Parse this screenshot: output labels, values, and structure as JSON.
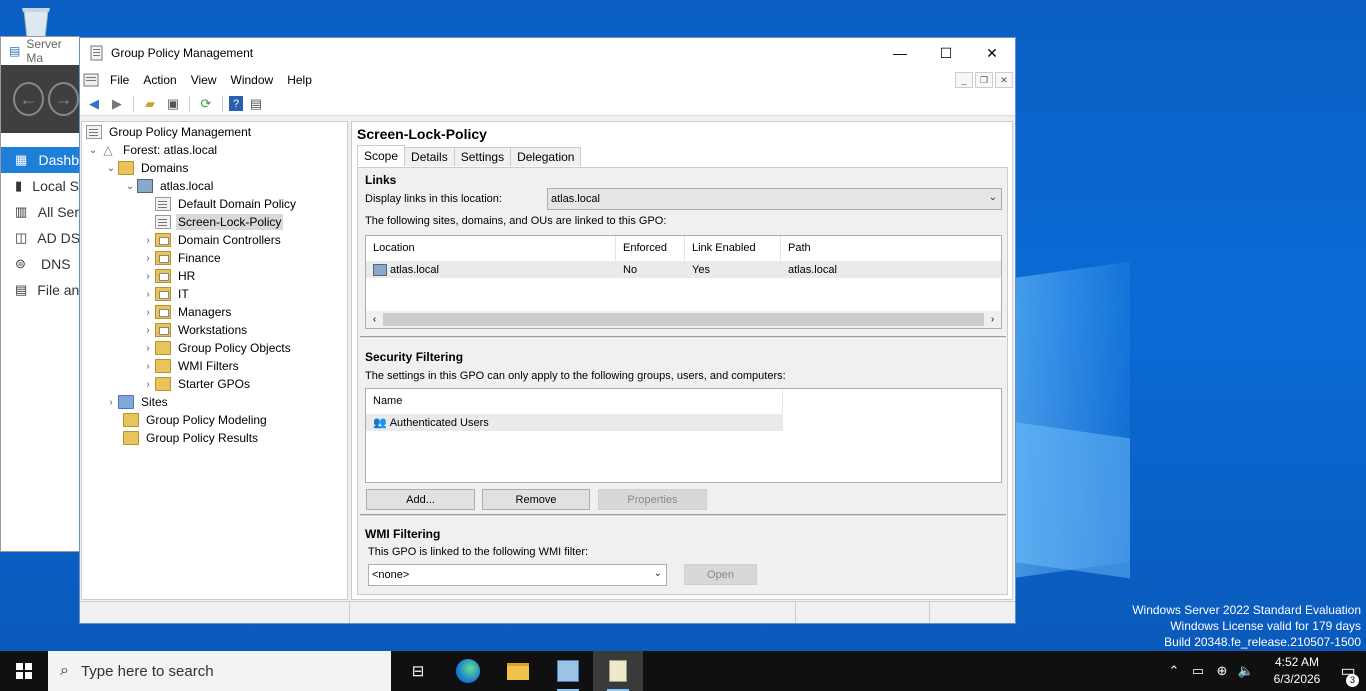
{
  "server_manager": {
    "title": "Server Ma",
    "items": [
      {
        "label": "Dashb",
        "icon": "dashboard-icon"
      },
      {
        "label": "Local S",
        "icon": "server-icon"
      },
      {
        "label": "All Ser",
        "icon": "servers-icon"
      },
      {
        "label": "AD DS",
        "icon": "ad-ds-icon"
      },
      {
        "label": "DNS",
        "icon": "dns-icon"
      },
      {
        "label": "File an",
        "icon": "file-services-icon"
      }
    ]
  },
  "window": {
    "title": "Group Policy Management",
    "minimize": "—",
    "maximize": "☐",
    "close": "✕"
  },
  "menu": [
    "File",
    "Action",
    "View",
    "Window",
    "Help"
  ],
  "tree": {
    "root": "Group Policy Management",
    "forest": "Forest: atlas.local",
    "domains": "Domains",
    "domain": "atlas.local",
    "children": [
      {
        "label": "Default Domain Policy",
        "type": "gpo"
      },
      {
        "label": "Screen-Lock-Policy",
        "type": "gpo",
        "selected": true
      },
      {
        "label": "Domain Controllers",
        "type": "ou"
      },
      {
        "label": "Finance",
        "type": "ou"
      },
      {
        "label": "HR",
        "type": "ou"
      },
      {
        "label": "IT",
        "type": "ou"
      },
      {
        "label": "Managers",
        "type": "ou"
      },
      {
        "label": "Workstations",
        "type": "ou"
      },
      {
        "label": "Group Policy Objects",
        "type": "folder"
      },
      {
        "label": "WMI Filters",
        "type": "folder"
      },
      {
        "label": "Starter GPOs",
        "type": "folder"
      }
    ],
    "sites": "Sites",
    "modeling": "Group Policy Modeling",
    "results": "Group Policy Results"
  },
  "gpo": {
    "name": "Screen-Lock-Policy",
    "tabs": [
      "Scope",
      "Details",
      "Settings",
      "Delegation"
    ],
    "links": {
      "heading": "Links",
      "display_label": "Display links in this location:",
      "location_value": "atlas.local",
      "linked_text": "The following sites, domains, and OUs are linked to this GPO:",
      "columns": [
        "Location",
        "Enforced",
        "Link Enabled",
        "Path"
      ],
      "rows": [
        {
          "location": "atlas.local",
          "enforced": "No",
          "link_enabled": "Yes",
          "path": "atlas.local"
        }
      ]
    },
    "security": {
      "heading": "Security Filtering",
      "text": "The settings in this GPO can only apply to the following groups, users, and computers:",
      "column": "Name",
      "rows": [
        "Authenticated Users"
      ],
      "add": "Add...",
      "remove": "Remove",
      "properties": "Properties"
    },
    "wmi": {
      "heading": "WMI Filtering",
      "text": "This GPO is linked to the following WMI filter:",
      "value": "<none>",
      "open": "Open"
    }
  },
  "watermark": {
    "line1": "Windows Server 2022 Standard Evaluation",
    "line2": "Windows License valid for 179 days",
    "line3": "Build 20348.fe_release.210507-1500"
  },
  "taskbar": {
    "search_placeholder": "Type here to search",
    "time": "4:52 AM",
    "date": "6/3/2026",
    "notifications": "3"
  }
}
